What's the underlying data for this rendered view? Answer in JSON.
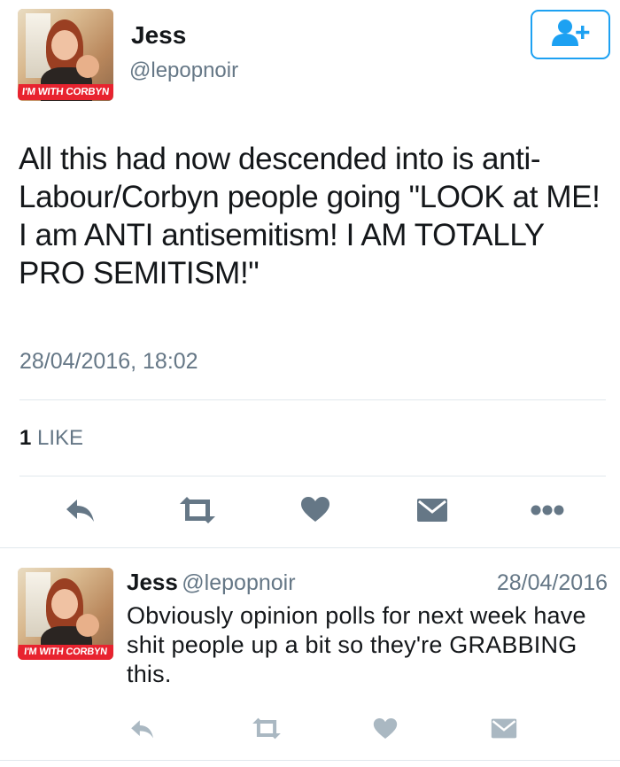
{
  "tweet": {
    "author": {
      "name": "Jess",
      "handle": "@lepopnoir",
      "avatar_banner": "I'M WITH CORBYN"
    },
    "text": "All this had now descended into is anti-Labour/Corbyn people going \"LOOK at ME! I am ANTI antisemitism! I AM TOTALLY PRO SEMITISM!\"",
    "timestamp": "28/04/2016, 18:02",
    "likes_count": "1",
    "likes_label": "LIKE",
    "actions": [
      "reply-icon",
      "retweet-icon",
      "like-icon",
      "message-icon",
      "more-icon"
    ]
  },
  "follow_button": {
    "icon": "add-user-icon"
  },
  "reply": {
    "author": {
      "name": "Jess",
      "handle": "@lepopnoir",
      "avatar_banner": "I'M WITH CORBYN"
    },
    "date": "28/04/2016",
    "text": "Obviously opinion polls for next week have shit people up a bit so they're GRABBING this.",
    "actions": [
      "reply-icon",
      "retweet-icon",
      "like-icon",
      "message-icon"
    ]
  },
  "colors": {
    "accent": "#1da1f2",
    "icon_dark": "#657786",
    "icon_light": "#aab8c2",
    "banner_red": "#e8232f"
  }
}
